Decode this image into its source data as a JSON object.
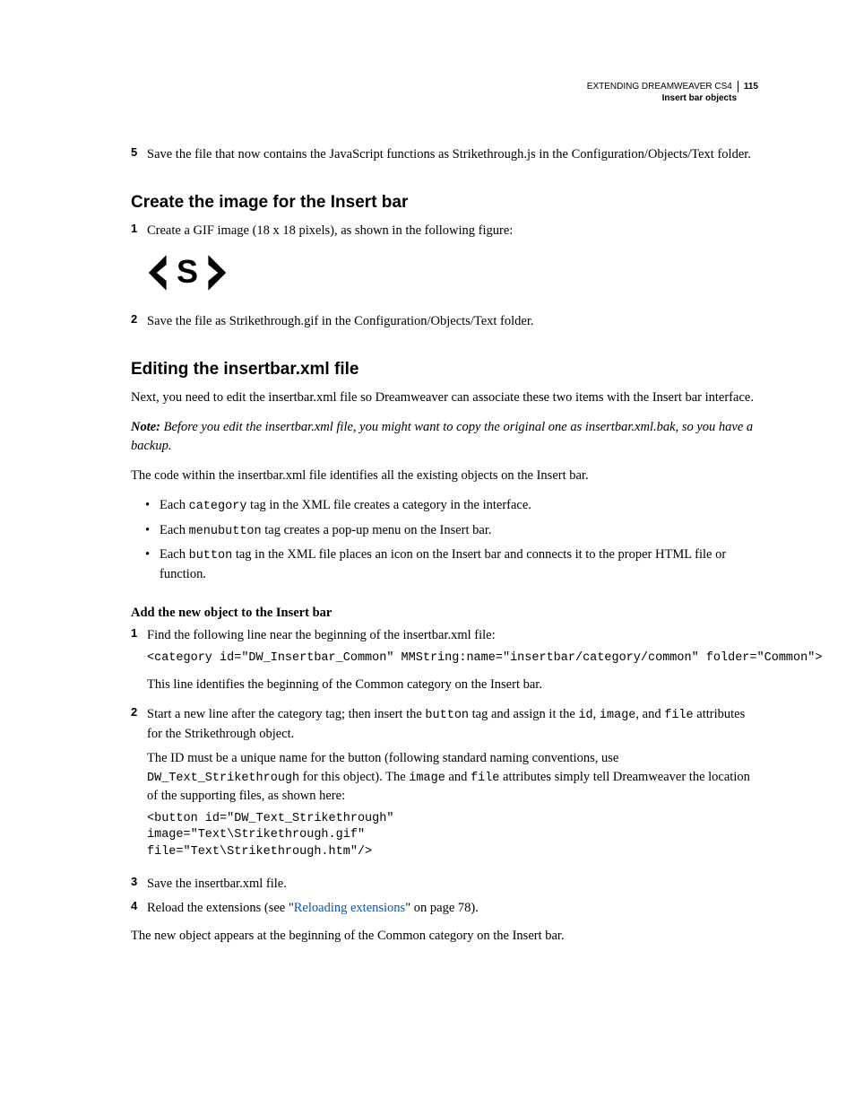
{
  "header": {
    "doc_title": "EXTENDING DREAMWEAVER CS4",
    "page_number": "115",
    "section": "Insert bar objects"
  },
  "step5": "Save the file that now contains the JavaScript functions as Strikethrough.js in the Configuration/Objects/Text folder.",
  "section1": {
    "title": "Create the image for the Insert bar",
    "step1": "Create a GIF image (18 x 18 pixels), as shown in the following figure:",
    "step2": "Save the file as Strikethrough.gif in the Configuration/Objects/Text folder."
  },
  "section2": {
    "title": "Editing the insertbar.xml file",
    "p1": "Next, you need to edit the insertbar.xml file so Dreamweaver can associate these two items with the Insert bar interface.",
    "note_lead": "Note: ",
    "note_body": "Before you edit the insertbar.xml file, you might want to copy the original one as insertbar.xml.bak, so you have a backup.",
    "p2": "The code within the insertbar.xml file identifies all the existing objects on the Insert bar.",
    "bul1_a": "Each ",
    "bul1_code": "category",
    "bul1_b": " tag in the XML file creates a category in the interface.",
    "bul2_a": "Each ",
    "bul2_code": "menubutton",
    "bul2_b": " tag creates a pop-up menu on the Insert bar.",
    "bul3_a": "Each ",
    "bul3_code": "button",
    "bul3_b": " tag in the XML file places an icon on the Insert bar and connects it to the proper HTML file or function.",
    "subhead": "Add the new object to the Insert bar",
    "s1": "Find the following line near the beginning of the insertbar.xml file:",
    "s1_code": "<category id=\"DW_Insertbar_Common\" MMString:name=\"insertbar/category/common\" folder=\"Common\">",
    "s1_p": "This line identifies the beginning of the Common category on the Insert bar.",
    "s2_a": "Start a new line after the category tag; then insert the ",
    "s2_code1": "button",
    "s2_b": " tag and assign it the ",
    "s2_code2": "id",
    "s2_c": ", ",
    "s2_code3": "image",
    "s2_d": ", and ",
    "s2_code4": "file",
    "s2_e": " attributes for the Strikethrough object.",
    "s2_p_a": "The ID must be a unique name for the button (following standard naming conventions, use ",
    "s2_p_code1": "DW_Text_Strikethrough",
    "s2_p_b": " for this object). The ",
    "s2_p_code2": "image",
    "s2_p_c": " and ",
    "s2_p_code3": "file",
    "s2_p_d": " attributes simply tell Dreamweaver the location of the supporting files, as shown here:",
    "s2_code": "<button id=\"DW_Text_Strikethrough\"\nimage=\"Text\\Strikethrough.gif\"\nfile=\"Text\\Strikethrough.htm\"/>",
    "s3": "Save the insertbar.xml file.",
    "s4_a": "Reload the extensions (see \"",
    "s4_link": "Reloading extensions",
    "s4_b": "\" on page 78).",
    "footer": "The new object appears at the beginning of the Common category on the Insert bar."
  }
}
